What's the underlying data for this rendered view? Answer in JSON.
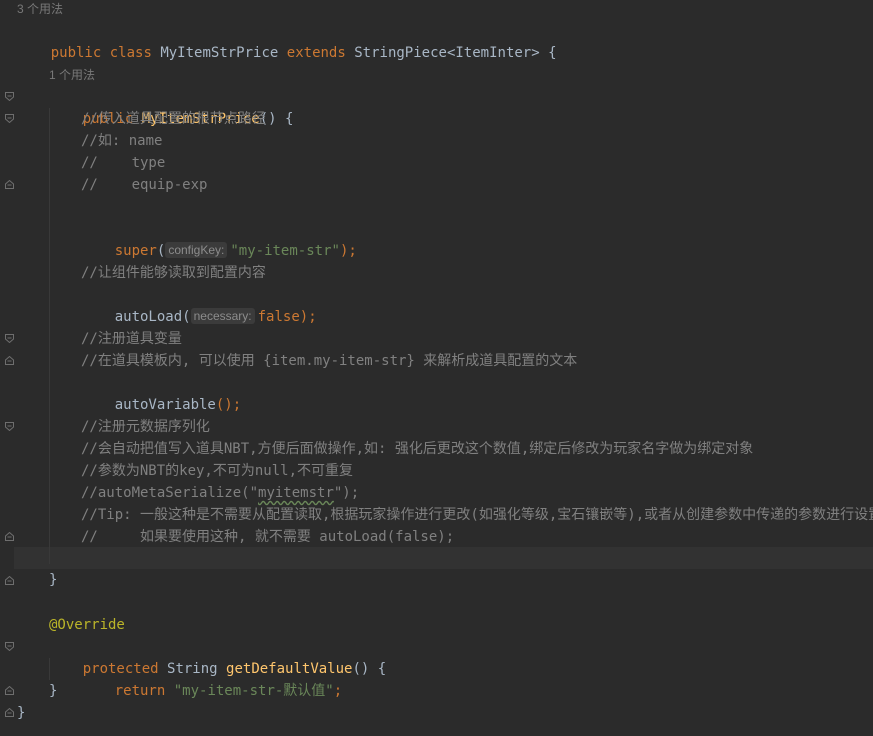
{
  "usage_hints": {
    "class_usage": "3 个用法",
    "ctor_usage": "1 个用法"
  },
  "code": {
    "l_class": {
      "kw1": "public",
      "kw2": "class",
      "name": "MyItemStrPrice",
      "kw3": "extends",
      "parent": "StringPiece<ItemInter>",
      "brace": "{"
    },
    "l_ctor": {
      "kw": "public",
      "name": "MyItemStrPrice",
      "rest": "() {"
    },
    "c1": "//传入道具配置的根节点路径",
    "c2": "//如: name",
    "c3": "//    type",
    "c4": "//    equip-exp",
    "l_super": {
      "call": "super",
      "open": "(",
      "hint": "configKey:",
      "arg": "\"my-item-str\"",
      "close": ");"
    },
    "c5": "//让组件能够读取到配置内容",
    "l_autoload": {
      "call": "autoLoad",
      "open": "(",
      "hint": "necessary:",
      "arg": "false",
      "close": ");"
    },
    "c6": "//注册道具变量",
    "c7": "//在道具模板内, 可以使用 {item.my-item-str} 来解析成道具配置的文本",
    "l_autovar": {
      "call": "autoVariable",
      "rest": "();"
    },
    "c8": "//注册元数据序列化",
    "c9": "//会自动把值写入道具NBT,方便后面做操作,如: 强化后更改这个数值,绑定后修改为玩家名字做为绑定对象",
    "c10": "//参数为NBT的key,不可为null,不可重复",
    "c11": {
      "pre": "//autoMetaSerialize(\"",
      "typo": "myitemstr",
      "post": "\");"
    },
    "c12": "//Tip: 一般这种是不需要从配置读取,根据玩家操作进行更改(如强化等级,宝石镶嵌等),或者从创建参数中传递的参数进行设置值",
    "c13": "//     如果要使用这种, 就不需要 autoLoad(false);",
    "close_ctor": "}",
    "annotation": "@Override",
    "l_method": {
      "kw": "protected",
      "type": "String",
      "name": "getDefaultValue",
      "rest": "() {"
    },
    "l_return": {
      "kw": "return",
      "str": "\"my-item-str-默认值\"",
      "end": ";"
    },
    "close_method": "}",
    "close_class": "}"
  },
  "colors": {
    "background": "#2b2b2b",
    "keyword": "#cc7832",
    "function": "#ffc66d",
    "string": "#6a8759",
    "comment": "#808080",
    "annotation": "#bbb529",
    "default_text": "#a9b7c6"
  }
}
